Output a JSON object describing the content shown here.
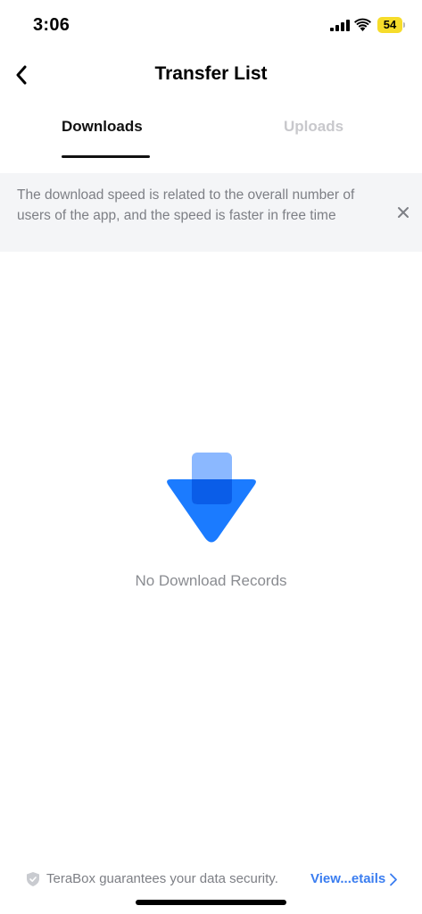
{
  "status_bar": {
    "time": "3:06",
    "battery": "54",
    "icons": [
      "signal-icon",
      "wifi-icon",
      "battery-icon"
    ]
  },
  "header": {
    "title": "Transfer List",
    "back_icon": "chevron-left-icon"
  },
  "tabs": [
    {
      "label": "Downloads",
      "active": true
    },
    {
      "label": "Uploads",
      "active": false
    }
  ],
  "notice": {
    "text": "The download speed is related to the overall number of users of the app, and the speed is faster in free time",
    "close_icon": "close-icon"
  },
  "empty_state": {
    "icon": "download-arrow-icon",
    "message": "No Download Records"
  },
  "footer": {
    "icon": "shield-icon",
    "text": "TeraBox guarantees your data security.",
    "link": "View...etails",
    "link_icon": "chevron-right-icon"
  },
  "colors": {
    "accent": "#1b7bff",
    "link": "#3a7df0",
    "muted_text": "#7d7f85",
    "notice_bg": "#f4f5f7",
    "inactive_tab": "#c8c8cc",
    "battery": "#f6dc2b"
  }
}
